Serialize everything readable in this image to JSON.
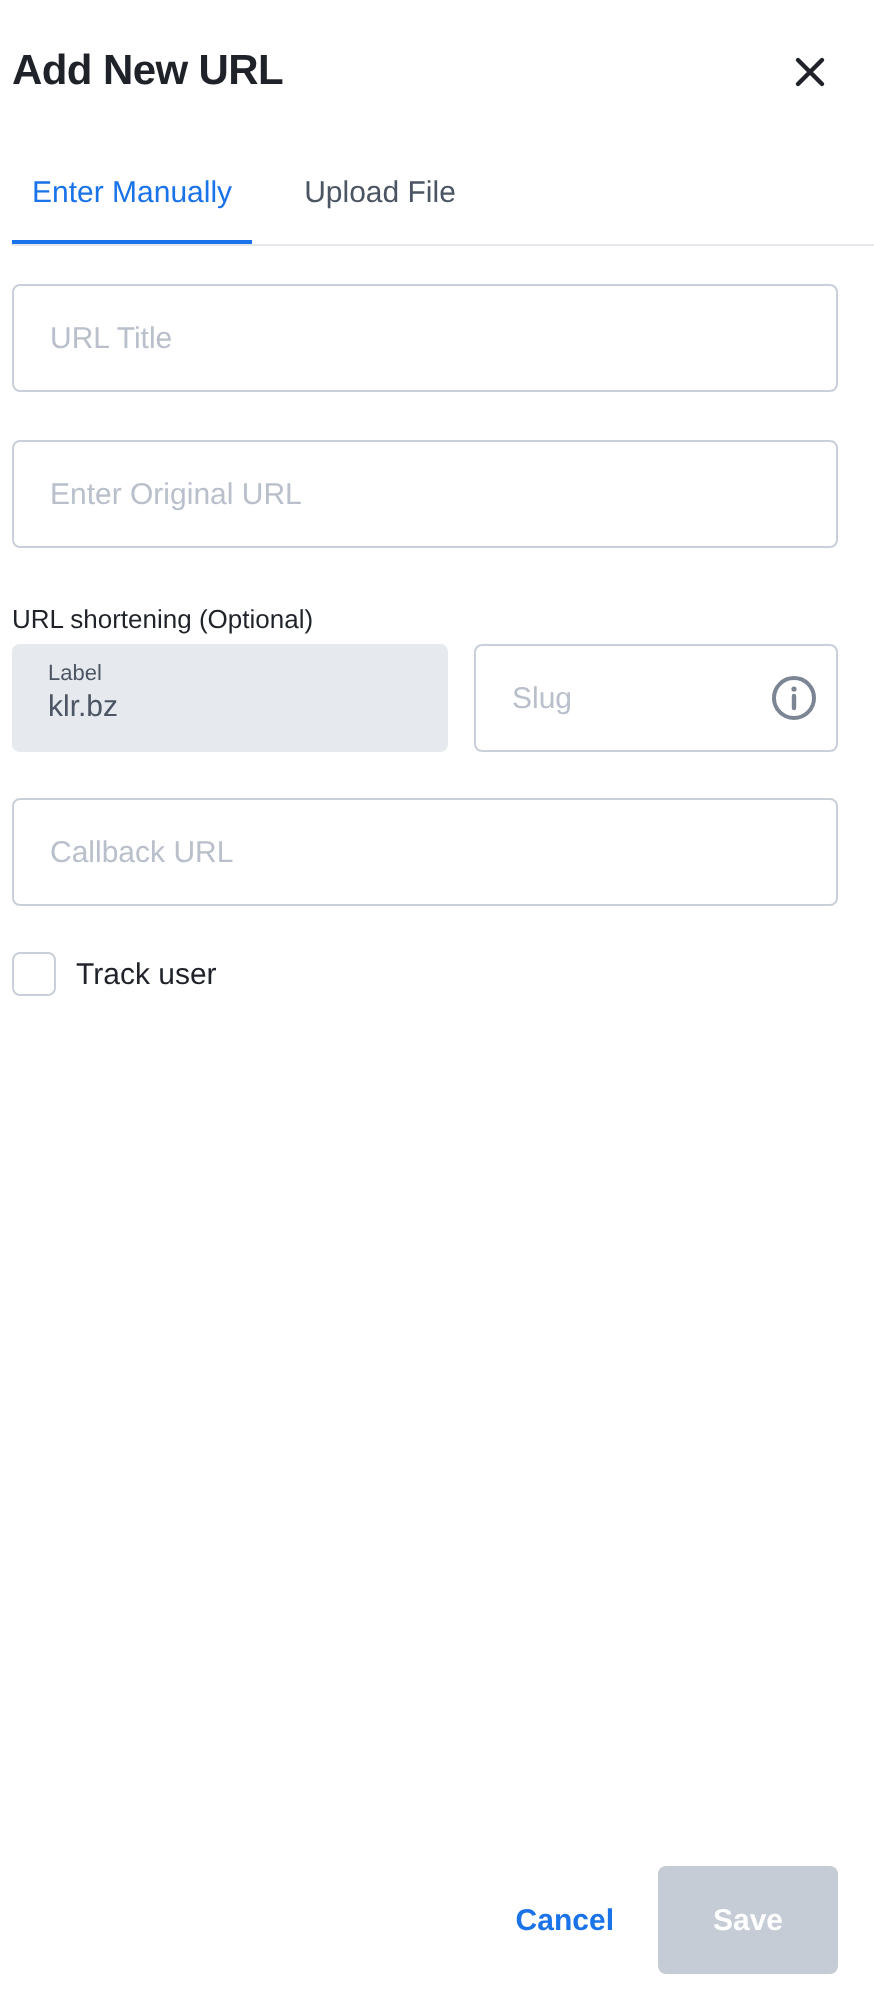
{
  "title": "Add New URL",
  "tabs": [
    {
      "label": "Enter Manually",
      "selected": true
    },
    {
      "label": "Upload File",
      "selected": false
    }
  ],
  "fields": [
    {
      "placeholder": "URL Title"
    },
    {
      "placeholder": "Enter Original URL"
    }
  ],
  "shortening": {
    "heading": "URL shortening (Optional)",
    "domain": {
      "label": "Label",
      "value": "klr.bz"
    },
    "slug": {
      "placeholder": "Slug"
    }
  },
  "callback": {
    "placeholder": "Callback URL"
  },
  "track_user": {
    "label": "Track user",
    "checked": false
  },
  "actions": {
    "cancel": "Cancel",
    "save": {
      "label": "Save",
      "disabled": true
    }
  }
}
